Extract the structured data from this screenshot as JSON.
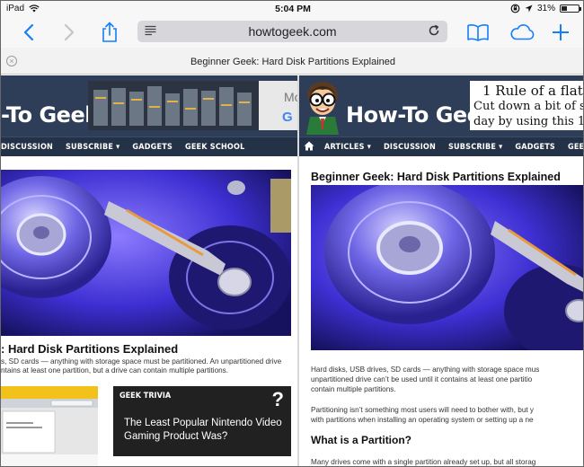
{
  "status_bar": {
    "device": "iPad",
    "time": "5:04 PM",
    "battery": "31%",
    "battery_level": 0.31
  },
  "toolbar": {
    "url": "howtogeek.com"
  },
  "tab": {
    "title": "Beginner Geek: Hard Disk Partitions Explained"
  },
  "left_pane": {
    "logo": "-To Geek",
    "nav": [
      "DISCUSSION",
      "SUBSCRIBE ▾",
      "GADGETS",
      "GEEK SCHOOL"
    ],
    "headline": ": Hard Disk Partitions Explained",
    "summary_lines": [
      "s, SD cards — anything with storage space must be partitioned. An unpartitioned drive",
      "ntains at least one partition, but a drive can contain multiple partitions."
    ],
    "trivia": {
      "tag": "GEEK TRIVIA",
      "mark": "?",
      "text": "The Least Popular Nintendo Video Gaming Product Was?"
    },
    "ad_partial": "Mo"
  },
  "right_pane": {
    "logo": "How-To Geek",
    "nav": [
      "ARTICLES ▾",
      "DISCUSSION",
      "SUBSCRIBE ▾",
      "GADGETS",
      "GEEK SCHOOL"
    ],
    "ad_lines": [
      "1 Rule of a flat",
      "Cut down a bit of s",
      "day by using this 1 w"
    ],
    "headline": "Beginner Geek: Hard Disk Partitions Explained",
    "para1": [
      "Hard disks, USB drives, SD cards — anything with storage space mus",
      "unpartitioned drive can’t be used until it contains at least one partitio",
      "contain multiple partitions."
    ],
    "para2": [
      "Partitioning isn’t something most users will need to bother with, but y",
      "with partitions when installing an operating system or setting up a ne"
    ],
    "subhead": "What is a Partition?",
    "para3": "Many drives come with a single partition already set up, but all storag"
  },
  "colors": {
    "header_bg": "#2e3e58",
    "nav_bg": "#243247",
    "accent_blue": "#147efb",
    "trivia_bg": "#212121"
  }
}
